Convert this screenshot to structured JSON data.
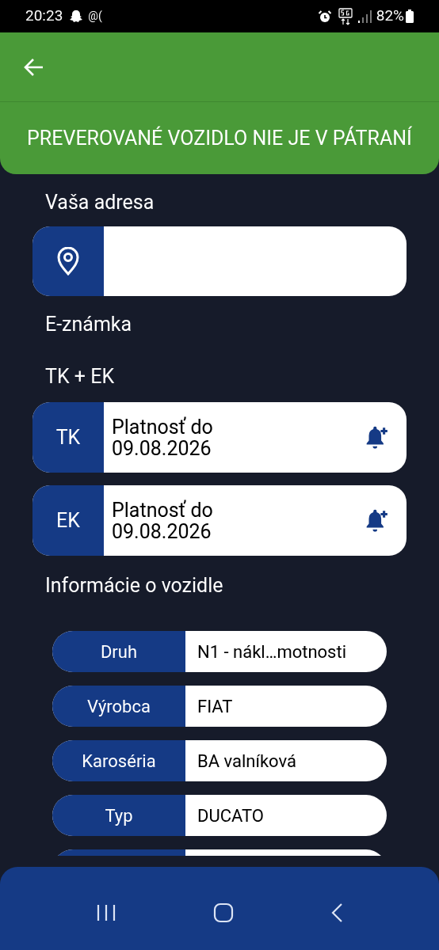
{
  "status_bar": {
    "time": "20:23",
    "notification": "@(",
    "battery": "82%"
  },
  "banner": "PREVEROVANÉ VOZIDLO NIE JE V PÁTRANÍ",
  "address": {
    "label": "Vaša adresa"
  },
  "sections": [
    "E-známka",
    "TK + EK"
  ],
  "inspections": [
    {
      "badge": "TK",
      "text": "Platnosť do\n09.08.2026"
    },
    {
      "badge": "EK",
      "text": "Platnosť do\n09.08.2026"
    }
  ],
  "vehicle_info": {
    "title": "Informácie o vozidle",
    "rows": [
      {
        "label": "Druh",
        "value": "N1 - nákl…motnosti"
      },
      {
        "label": "Výrobca",
        "value": "FIAT"
      },
      {
        "label": "Karoséria",
        "value": "BA valníková"
      },
      {
        "label": "Typ",
        "value": "DUCATO"
      }
    ]
  }
}
